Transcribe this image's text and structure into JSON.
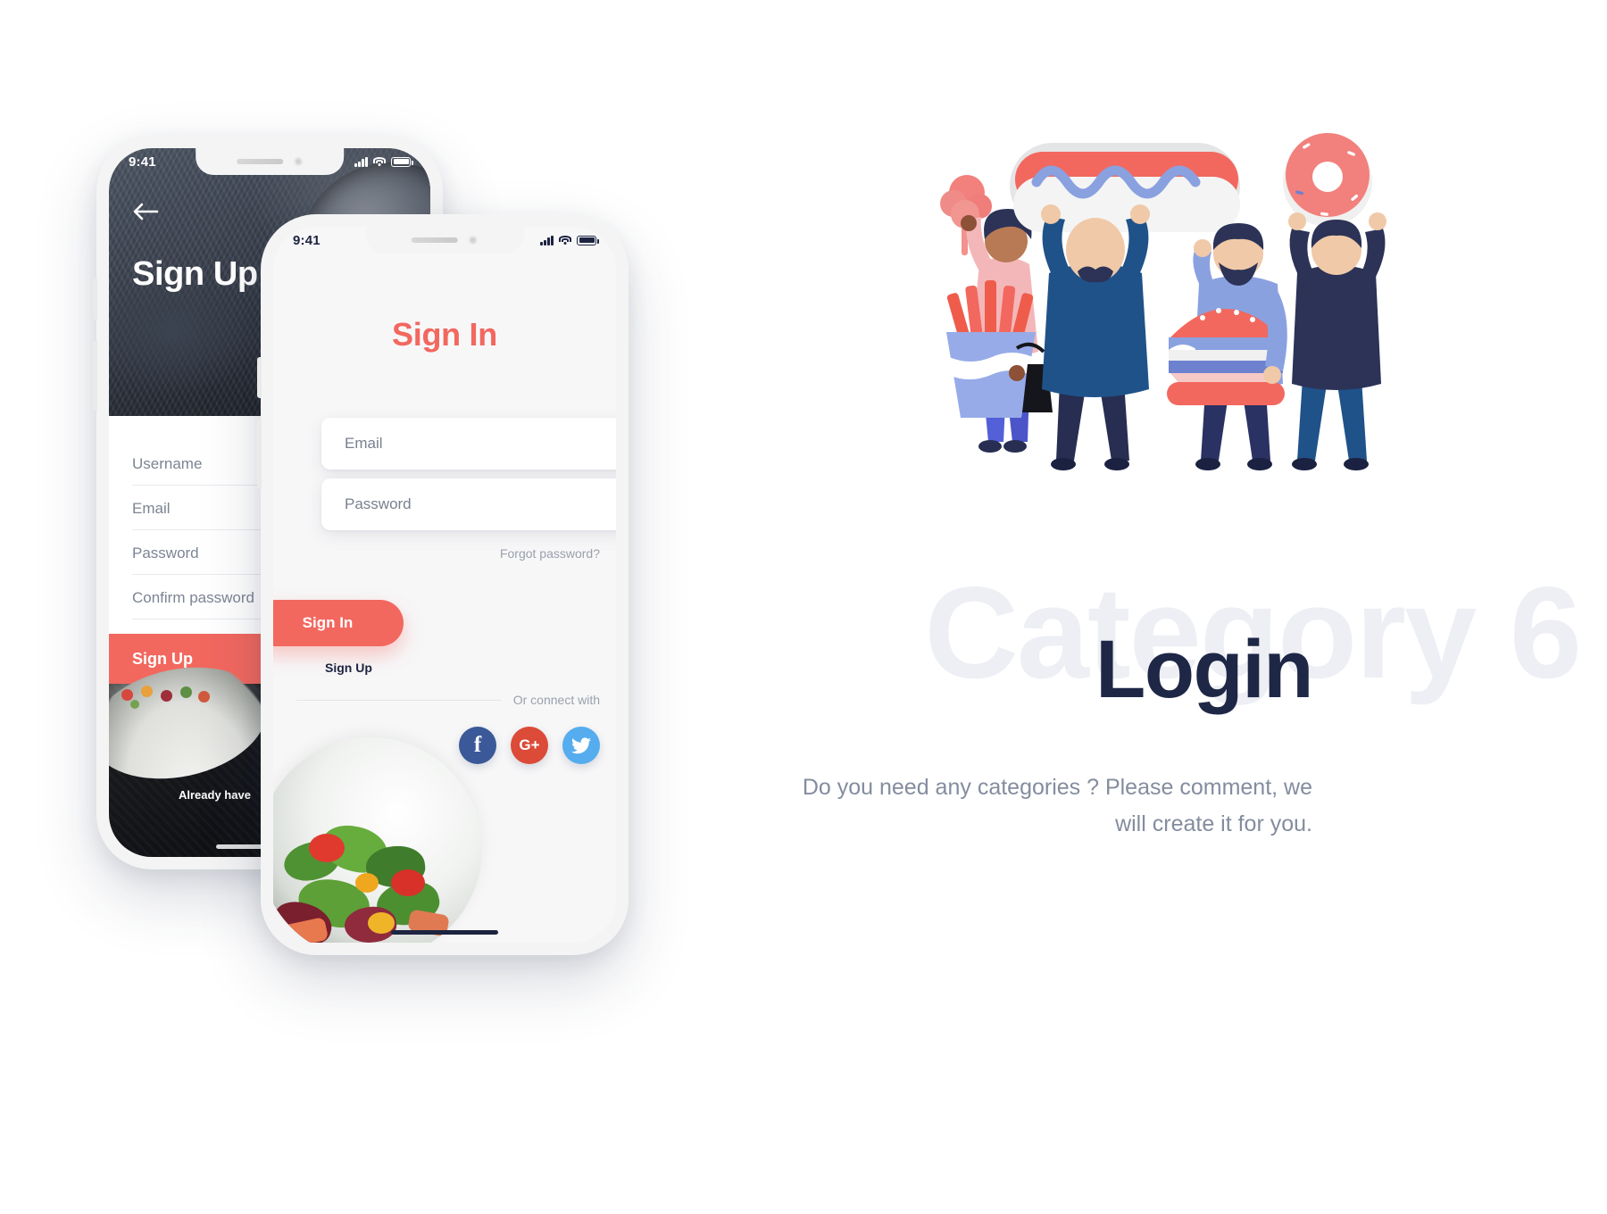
{
  "phone_back": {
    "name": "sign-up-screen",
    "statusbar": {
      "time": "9:41",
      "signal": "signal-bars",
      "wifi": "wifi-icon",
      "battery": "battery-icon"
    },
    "back_icon": "back-arrow-icon",
    "title": "Sign Up",
    "fields": [
      {
        "label": "Username"
      },
      {
        "label": "Email"
      },
      {
        "label": "Password"
      },
      {
        "label": "Confirm password"
      }
    ],
    "submit_label": "Sign Up",
    "footer_text": "Already have"
  },
  "phone_front": {
    "name": "sign-in-screen",
    "statusbar": {
      "time": "9:41",
      "signal": "signal-bars",
      "wifi": "wifi-icon",
      "battery": "battery-icon"
    },
    "title": "Sign In",
    "email_placeholder": "Email",
    "password_placeholder": "Password",
    "forgot_label": "Forgot password?",
    "submit_label": "Sign In",
    "signup_label": "Sign Up",
    "connect_label": "Or connect with",
    "social": [
      {
        "name": "facebook",
        "glyph": "f",
        "color": "#3b5998"
      },
      {
        "name": "google-plus",
        "glyph": "G+",
        "color": "#dc4a38"
      },
      {
        "name": "twitter",
        "glyph": "",
        "color": "#55acee"
      }
    ]
  },
  "right_panel": {
    "ghost_title": "Category 6",
    "heading": "Login",
    "tagline": "Do you need any categories ? Please comment, we will create it for you."
  },
  "illustration": {
    "name": "people-holding-fast-food-illustration",
    "items": [
      "cotton-candy",
      "french-fries",
      "hot-dog",
      "hamburger",
      "donut"
    ]
  },
  "colors": {
    "accent": "#f2685f",
    "navy": "#1e2746",
    "ghost": "#edeff4",
    "muted": "#848c9e",
    "facebook": "#3b5998",
    "google": "#dc4a38",
    "twitter": "#55acee"
  }
}
